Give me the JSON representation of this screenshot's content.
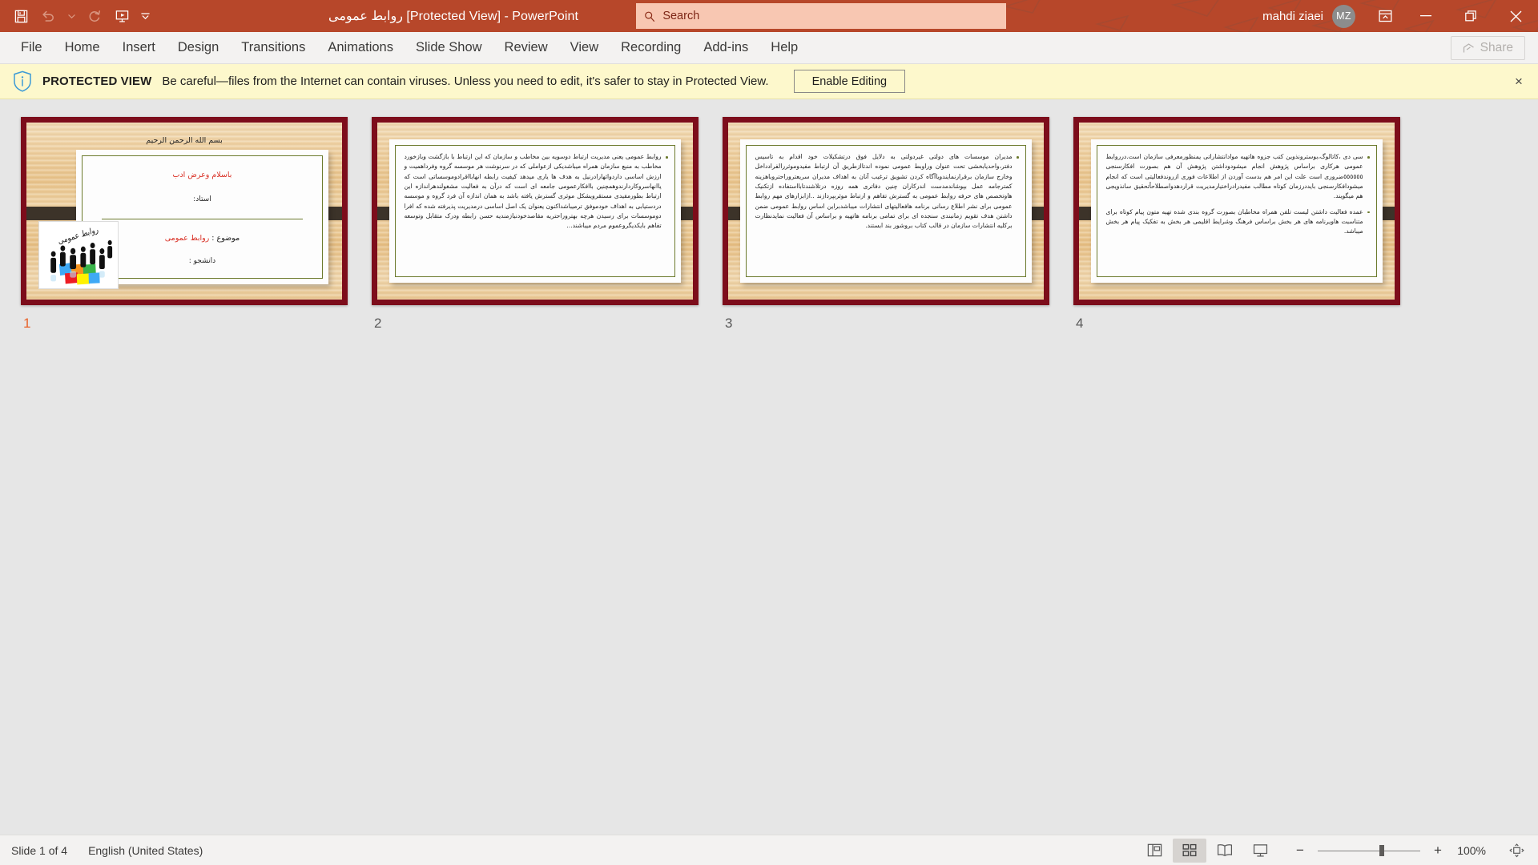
{
  "titlebar": {
    "quick_access": [
      {
        "name": "save",
        "label": "Save",
        "enabled": true
      },
      {
        "name": "undo",
        "label": "Undo",
        "enabled": false
      },
      {
        "name": "undo-dropdown",
        "label": "Undo options",
        "enabled": false
      },
      {
        "name": "redo",
        "label": "Redo",
        "enabled": false
      },
      {
        "name": "start-slideshow",
        "label": "Start From Beginning",
        "enabled": true
      },
      {
        "name": "customize-qat",
        "label": "Customize Quick Access Toolbar",
        "enabled": true
      }
    ],
    "document_name": "روابط عمومی",
    "protected_tag": "[Protected View]",
    "separator": "-",
    "app_name": "PowerPoint",
    "search_placeholder": "Search",
    "account_name": "mahdi ziaei",
    "account_initials": "MZ",
    "ribbon_display_options": "Ribbon Display Options",
    "minimize": "Minimize",
    "restore": "Restore Down",
    "close": "Close",
    "accent_color": "#b7472a",
    "search_bg": "#f8c7b2"
  },
  "ribbon": {
    "tabs": [
      {
        "label": "File"
      },
      {
        "label": "Home"
      },
      {
        "label": "Insert"
      },
      {
        "label": "Design"
      },
      {
        "label": "Transitions"
      },
      {
        "label": "Animations"
      },
      {
        "label": "Slide Show"
      },
      {
        "label": "Review"
      },
      {
        "label": "View"
      },
      {
        "label": "Recording"
      },
      {
        "label": "Add-ins"
      },
      {
        "label": "Help"
      }
    ],
    "share_label": "Share",
    "share_enabled": false
  },
  "protected_view": {
    "label": "PROTECTED VIEW",
    "message": "Be careful—files from the Internet can contain viruses. Unless you need to edit, it's safer to stay in Protected View.",
    "button_label": "Enable Editing",
    "close_label": "×",
    "bg_color": "#fdf8cc"
  },
  "slides": [
    {
      "number": "1",
      "selected": true,
      "type": "title",
      "bismillah": "بسم الله الرحمن الرحیم",
      "line1": "باسلام وعرض ادب",
      "line2": "استاد:",
      "line3_prefix": "موضوع : ",
      "line3_value": "روابط عمومی",
      "line4": "دانشجو :",
      "clipart_caption": "روابط عمومی"
    },
    {
      "number": "2",
      "selected": false,
      "type": "body",
      "paragraphs": [
        "روابط عمومی یعنی مدیریت ارتباط دوسویه بین مخاطب و سازمان که این ارتباط با بازگشت وبازخورد مخاطب به منبع سازمان همراه میباشدیکی ازعواملی که در سرنوشت هر موسسه گروه وفرداهمیت و ارزش اساسی داردواثهارادرنیل به هدف ها یاری میدهد کیفیت رابطه انهابااقرادوموسساتی است که یاانهاسروکاردارندوهمچنین باافکارعمومی جامعه ای است که درآن به فعالیت مشغولندهراندازه این ارتباط بطورمفیدی مستقرویشکل موثری گسترش یافته باشد به همان اندازه آن فرد گروه و موسسه دردستیابی به اهداف خودموفق ترمیباشداکنون یعنوان یک اصل اساسی درمدیریت پذیرفته شده که افرا دوموسسات برای رسیدن هرچه بهتروراحتریه مقاصدخودنیازمندیه حسن رابطه ودرک متقابل وتوسعه تفاهم بایکدیگروعموم مردم میباشند..."
      ]
    },
    {
      "number": "3",
      "selected": false,
      "type": "body",
      "paragraphs": [
        "مدیران موسسات های دولتی غیردولتی به دلایل فوق درتشکیلات خود اقدام به تاسیس دفتر،واحدیابخشی تحت عنوان وراوبط عمومی نموده اندتاازطریق آن ارتباط مفیدوموثررالفرادداخل وخارج سازمان برقرارنمایندویاآگاه کردن تشویق ترغیب آنان به اهداف مدیران سریعتروراحتروباهزینه کمترجامه عمل بپوشاندمدست اندرکاران چنین دفاتری همه روزه درتلاشندتابااستفاده ازتکنیک هاوتخصص های حرفه روابط عمومی به گسترش تفاهم و ارتباط موثربپردازند ..ازابزارهای مهم روابط عمومی برای نشر اطلاع رسانی برنامه هافعالیتهای انتشارات میباشدبراین اساس روابط عمومی ضمن داشتن هدف تقویم زمانبندی سنجده ای برای تمامی برنامه هاتهیه و براساس آن فعالیت نمایدنظارت برکلیه انتشارات سازمان در قالب کتاب بروشور بند ابستند."
      ]
    },
    {
      "number": "4",
      "selected": false,
      "type": "body",
      "paragraphs": [
        "سی دی ،کاتالوگ،بوسترونذوین کتب جزوه هاتهیه موادانتشاراتی یمنظورمعرفی سازمان است.درروابط عمومی هرکاری براساس پژوهش انجام میشودوداشتن پژوهش آن هم بصورت افکارسنجی ٥٥٥٥٥٥ضروری است علت این امر هم بدست آوردن از اطلاعات فوری ازروندفعالیتی است که انجام میشودافکارسنجی بایددرزمان کوتاه مطالب مفیدرادراختیارمدیریت قراردهدواصطلاحاًتحقیق سانذویجی هم میگویند.",
        "عمده فعالیت داشتن لیست تلفن همراه مخاطبان بصورت گروه بندی شده تهیه متون پیام کوتاه برای متناسبت هاویرنامه های هر بخش براساس فرهنگ وشرایط اقلیمی هر بخش به تفکیک پیام هر بخش میباشد."
      ]
    }
  ],
  "statusbar": {
    "slide_counter": "Slide 1 of 4",
    "language": "English (United States)",
    "views": [
      {
        "name": "normal-view",
        "label": "Normal",
        "active": false
      },
      {
        "name": "slide-sorter-view",
        "label": "Slide Sorter",
        "active": true
      },
      {
        "name": "reading-view",
        "label": "Reading View",
        "active": false
      },
      {
        "name": "slide-show-view",
        "label": "Slide Show",
        "active": false
      }
    ],
    "zoom_out_label": "−",
    "zoom_in_label": "+",
    "zoom_level": "100%",
    "fit_label": "Fit slide to current window"
  }
}
